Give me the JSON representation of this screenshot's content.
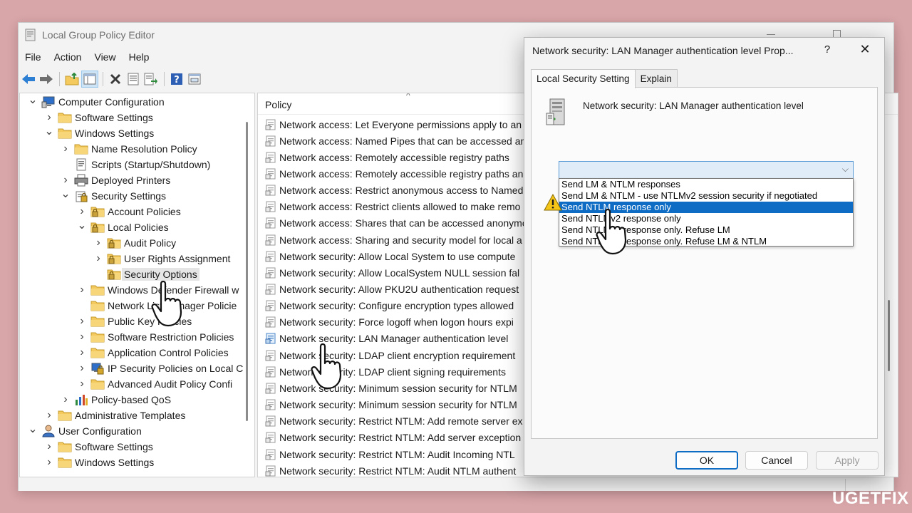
{
  "window": {
    "title": "Local Group Policy Editor"
  },
  "menu": [
    "File",
    "Action",
    "View",
    "Help"
  ],
  "toolbar": {
    "buttons": [
      "back-arrow-icon",
      "forward-arrow-icon",
      "up-folder-icon",
      "show-hide-tree-icon",
      "delete-icon",
      "properties-icon",
      "export-list-icon",
      "help-icon",
      "console-view-icon"
    ]
  },
  "tree": {
    "items": [
      {
        "label": "Computer Configuration",
        "level": 0,
        "expander": "expanded",
        "icon": "computer-icon"
      },
      {
        "label": "Software Settings",
        "level": 1,
        "expander": "collapsed",
        "icon": "folder-icon"
      },
      {
        "label": "Windows Settings",
        "level": 1,
        "expander": "expanded",
        "icon": "folder-icon"
      },
      {
        "label": "Name Resolution Policy",
        "level": 2,
        "expander": "collapsed",
        "icon": "folder-icon"
      },
      {
        "label": "Scripts (Startup/Shutdown)",
        "level": 2,
        "expander": "none",
        "icon": "script-icon"
      },
      {
        "label": "Deployed Printers",
        "level": 2,
        "expander": "collapsed",
        "icon": "printer-icon"
      },
      {
        "label": "Security Settings",
        "level": 2,
        "expander": "expanded",
        "icon": "security-settings-icon"
      },
      {
        "label": "Account Policies",
        "level": 3,
        "expander": "collapsed",
        "icon": "locked-folder-icon"
      },
      {
        "label": "Local Policies",
        "level": 3,
        "expander": "expanded",
        "icon": "locked-folder-icon"
      },
      {
        "label": "Audit Policy",
        "level": 4,
        "expander": "collapsed",
        "icon": "locked-folder-icon"
      },
      {
        "label": "User Rights Assignment",
        "level": 4,
        "expander": "collapsed",
        "icon": "locked-folder-icon"
      },
      {
        "label": "Security Options",
        "level": 4,
        "expander": "none",
        "icon": "locked-folder-icon",
        "selected": true
      },
      {
        "label": "Windows Defender Firewall w",
        "level": 3,
        "expander": "collapsed",
        "icon": "folder-icon"
      },
      {
        "label": "Network List Manager Policie",
        "level": 3,
        "expander": "none",
        "icon": "folder-icon"
      },
      {
        "label": "Public Key Policies",
        "level": 3,
        "expander": "collapsed",
        "icon": "folder-icon"
      },
      {
        "label": "Software Restriction Policies",
        "level": 3,
        "expander": "collapsed",
        "icon": "folder-icon"
      },
      {
        "label": "Application Control Policies",
        "level": 3,
        "expander": "collapsed",
        "icon": "folder-icon"
      },
      {
        "label": "IP Security Policies on Local C",
        "level": 3,
        "expander": "collapsed",
        "icon": "ip-security-icon"
      },
      {
        "label": "Advanced Audit Policy Confi",
        "level": 3,
        "expander": "collapsed",
        "icon": "folder-icon"
      },
      {
        "label": "Policy-based QoS",
        "level": 2,
        "expander": "collapsed",
        "icon": "qos-chart-icon"
      },
      {
        "label": "Administrative Templates",
        "level": 1,
        "expander": "collapsed",
        "icon": "folder-icon"
      },
      {
        "label": "User Configuration",
        "level": 0,
        "expander": "expanded",
        "icon": "user-icon"
      },
      {
        "label": "Software Settings",
        "level": 1,
        "expander": "collapsed",
        "icon": "folder-icon"
      },
      {
        "label": "Windows Settings",
        "level": 1,
        "expander": "collapsed",
        "icon": "folder-icon"
      }
    ]
  },
  "list": {
    "column_header": "Policy",
    "sort_glyph": "^",
    "rows": [
      {
        "label": "Network access: Let Everyone permissions apply to an"
      },
      {
        "label": "Network access: Named Pipes that can be accessed an"
      },
      {
        "label": "Network access: Remotely accessible registry paths"
      },
      {
        "label": "Network access: Remotely accessible registry paths an"
      },
      {
        "label": "Network access: Restrict anonymous access to Named"
      },
      {
        "label": "Network access: Restrict clients allowed to make remo"
      },
      {
        "label": "Network access: Shares that can be accessed anonymo"
      },
      {
        "label": "Network access: Sharing and security model for local a"
      },
      {
        "label": "Network security: Allow Local System to use compute"
      },
      {
        "label": "Network security: Allow LocalSystem NULL session fal"
      },
      {
        "label": "Network security: Allow PKU2U authentication request"
      },
      {
        "label": "Network security: Configure encryption types allowed"
      },
      {
        "label": "Network security: Force logoff when logon hours expi"
      },
      {
        "label": "Network security: LAN Manager authentication level",
        "active": true
      },
      {
        "label": "Network security: LDAP client encryption requirement"
      },
      {
        "label": "Network security: LDAP client signing requirements"
      },
      {
        "label": "Network security: Minimum session security for NTLM"
      },
      {
        "label": "Network security: Minimum session security for NTLM"
      },
      {
        "label": "Network security: Restrict NTLM: Add remote server ex"
      },
      {
        "label": "Network security: Restrict NTLM: Add server exception"
      },
      {
        "label": "Network security: Restrict NTLM: Audit Incoming NTL"
      },
      {
        "label": "Network security: Restrict NTLM: Audit NTLM authent"
      }
    ]
  },
  "dialog": {
    "title": "Network security: LAN Manager authentication level Prop...",
    "help_glyph": "?",
    "close_glyph": "✕",
    "tabs": [
      {
        "label": "Local Security Setting",
        "active": true
      },
      {
        "label": "Explain",
        "active": false
      }
    ],
    "heading": "Network security: LAN Manager authentication level",
    "combo": {
      "value": "",
      "chevron": "⌵"
    },
    "options": [
      {
        "label": "Send LM & NTLM responses",
        "selected": false
      },
      {
        "label": "Send LM & NTLM - use NTLMv2 session security if negotiated",
        "selected": false
      },
      {
        "label": "Send NTLM response only",
        "selected": true
      },
      {
        "label": "Send NTLMv2 response only",
        "selected": false
      },
      {
        "label": "Send NTLMv2 response only. Refuse LM",
        "selected": false
      },
      {
        "label": "Send NTLMv2 response only. Refuse LM & NTLM",
        "selected": false
      }
    ],
    "buttons": {
      "ok": "OK",
      "cancel": "Cancel",
      "apply": "Apply"
    }
  },
  "watermark": {
    "text_a": "UG",
    "text_b": "ETFIX"
  },
  "colors": {
    "background": "#d8a5a8",
    "selection_blue": "#0e6cc4",
    "combo_fill": "#e0ecf8",
    "folder_yellow": "#f4c95d"
  }
}
